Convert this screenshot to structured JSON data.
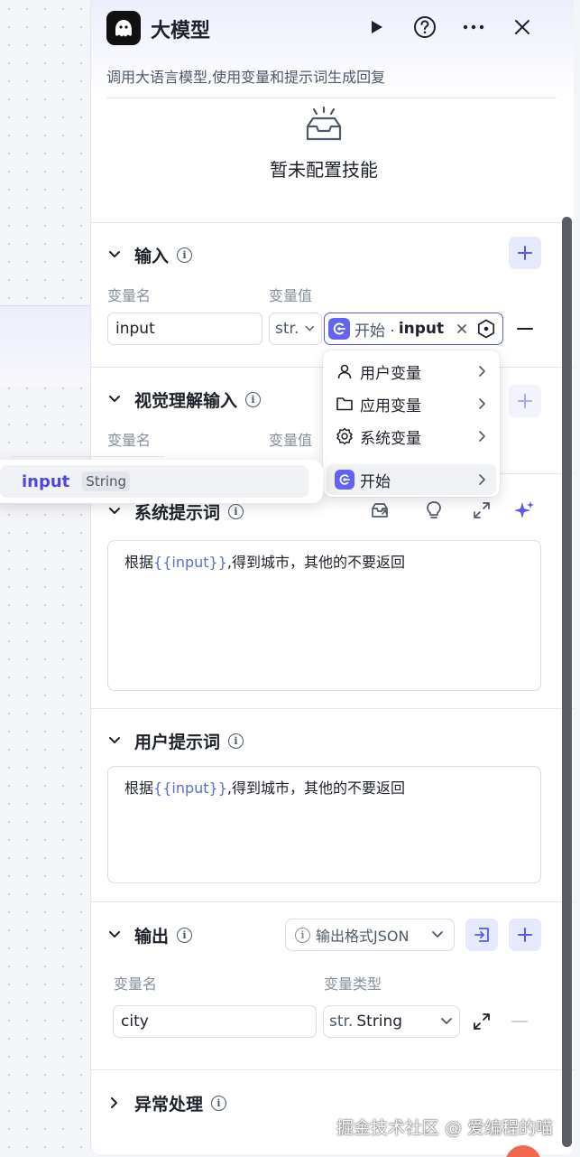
{
  "header": {
    "title": "大模型",
    "description": "调用大语言模型,使用变量和提示词生成回复"
  },
  "skill": {
    "empty_label": "暂未配置技能"
  },
  "input_section": {
    "title": "输入",
    "col_name": "变量名",
    "col_value": "变量值",
    "row": {
      "name": "input",
      "type": "str.",
      "ref_source": "开始 ·",
      "ref_var": "input"
    }
  },
  "dropdown": {
    "items": [
      {
        "label": "用户变量",
        "icon": "user-icon"
      },
      {
        "label": "应用变量",
        "icon": "folder-icon"
      },
      {
        "label": "系统变量",
        "icon": "gear-icon"
      },
      {
        "label": "开始",
        "icon": "start-node-icon"
      }
    ]
  },
  "suggestion": {
    "name": "input",
    "type": "String"
  },
  "vision_section": {
    "title": "视觉理解输入",
    "col_name": "变量名",
    "col_value": "变量值"
  },
  "system_prompt": {
    "title": "系统提示词",
    "before": "根据",
    "var": "{{input}}",
    "after": ",得到城市，其他的不要返回"
  },
  "user_prompt": {
    "title": "用户提示词",
    "before": "根据",
    "var": "{{input}}",
    "after": ",得到城市，其他的不要返回"
  },
  "output_section": {
    "title": "输出",
    "format_label": "输出格式JSON",
    "col_name": "变量名",
    "col_type": "变量类型",
    "row": {
      "name": "city",
      "type_prefix": "str.",
      "type": "String"
    }
  },
  "exception_section": {
    "title": "异常处理"
  },
  "watermark": "掘金技术社区 @ 爱编程的喵",
  "colors": {
    "accent": "#5b57e8",
    "accent_bg": "#e6e8fb",
    "start_badge": "#6462f0"
  }
}
